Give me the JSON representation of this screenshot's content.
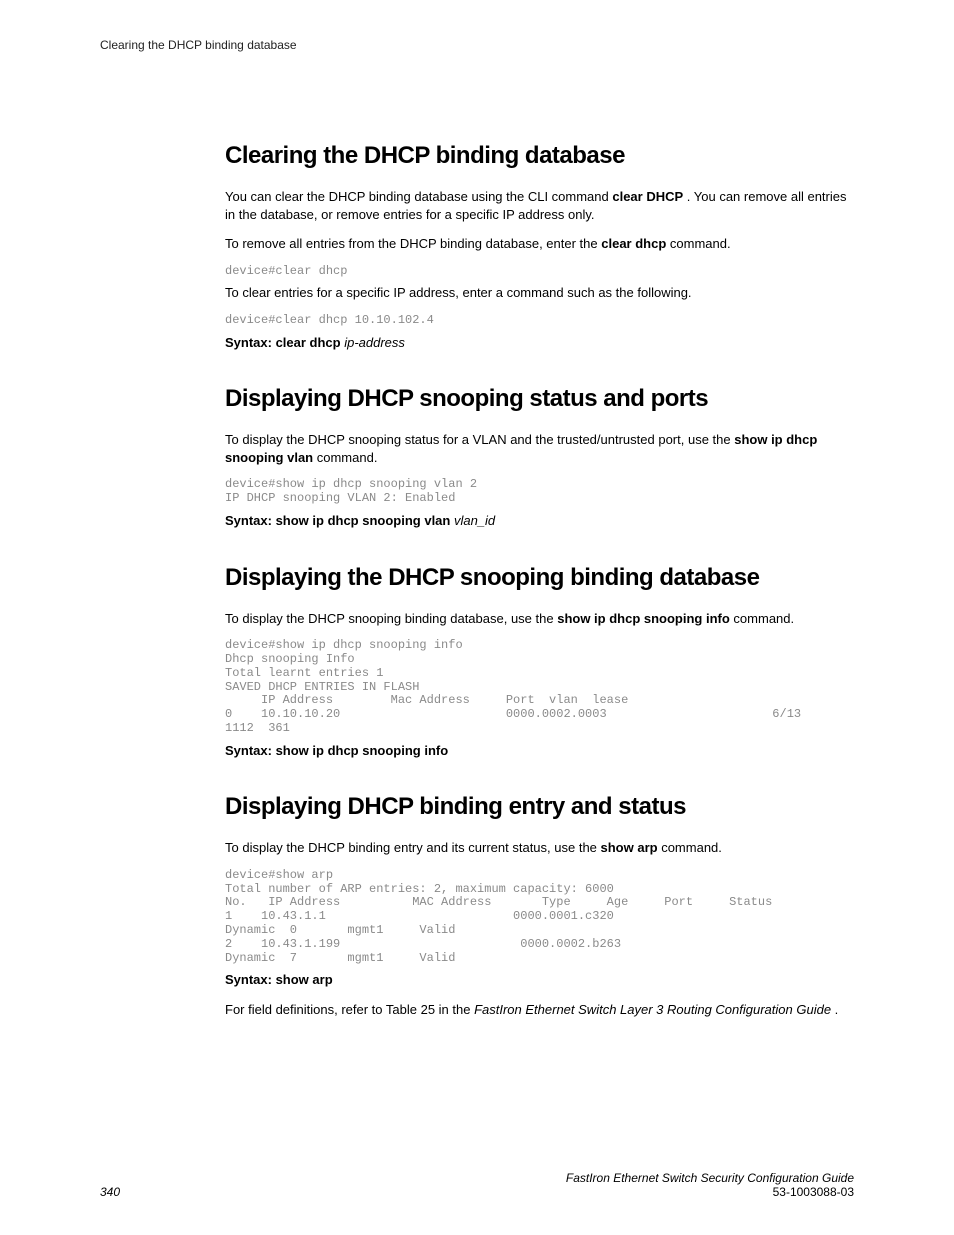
{
  "runningHeader": "Clearing the DHCP binding database",
  "sections": {
    "s1": {
      "title": "Clearing the DHCP binding database",
      "p1a": "You can clear the DHCP binding database using the CLI command ",
      "p1b": "clear DHCP",
      "p1c": " . You can remove all entries in the database, or remove entries for a specific IP address only.",
      "p2a": "To remove all entries from the DHCP binding database, enter the ",
      "p2b": "clear dhcp",
      "p2c": " command.",
      "code1": "device#clear dhcp",
      "p3": "To clear entries for a specific IP address, enter a command such as the following.",
      "code2": "device#clear dhcp 10.10.102.4",
      "synLead": "Syntax: clear dhcp ",
      "synArg": "ip-address"
    },
    "s2": {
      "title": "Displaying DHCP snooping status and ports",
      "p1a": "To display the DHCP snooping status for a VLAN and the trusted/untrusted port, use the ",
      "p1b": "show ip dhcp snooping vlan",
      "p1c": " command.",
      "code1": "device#show ip dhcp snooping vlan 2\nIP DHCP snooping VLAN 2: Enabled",
      "synLead": "Syntax: show ip dhcp snooping vlan ",
      "synArg": "vlan_id"
    },
    "s3": {
      "title": "Displaying the DHCP snooping binding database",
      "p1a": "To display the DHCP snooping binding database, use the ",
      "p1b": "show ip dhcp snooping info",
      "p1c": " command.",
      "code1": "device#show ip dhcp snooping info\nDhcp snooping Info\nTotal learnt entries 1\nSAVED DHCP ENTRIES IN FLASH\n     IP Address        Mac Address     Port  vlan  lease\n0    10.10.10.20                       0000.0002.0003                       6/13\n1112  361",
      "synLead": "Syntax: show ip dhcp snooping info"
    },
    "s4": {
      "title": "Displaying DHCP binding entry and status",
      "p1a": "To display the DHCP binding entry and its current status, use the ",
      "p1b": "show arp",
      "p1c": " command.",
      "code1": "device#show arp\nTotal number of ARP entries: 2, maximum capacity: 6000\nNo.   IP Address          MAC Address       Type     Age     Port     Status\n1    10.43.1.1                          0000.0001.c320\nDynamic  0       mgmt1     Valid\n2    10.43.1.199                         0000.0002.b263\nDynamic  7       mgmt1     Valid",
      "synLead": "Syntax: show arp",
      "p2a": "For field definitions, refer to Table 25 in the ",
      "p2b": "FastIron Ethernet Switch Layer 3 Routing Configuration Guide ",
      "p2c": "."
    }
  },
  "footer": {
    "pageNum": "340",
    "title": "FastIron Ethernet Switch Security Configuration Guide",
    "docnum": "53-1003088-03"
  }
}
